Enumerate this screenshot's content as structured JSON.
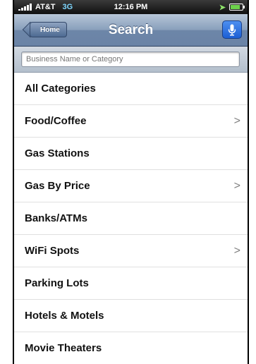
{
  "status_bar": {
    "carrier": "AT&T",
    "network": "3G",
    "time": "12:16 PM",
    "location_icon": "location-arrow-icon",
    "battery_level": 0.8
  },
  "nav": {
    "back_label": "Home",
    "title": "Search",
    "mic_icon": "microphone-icon"
  },
  "search": {
    "placeholder": "Business Name or Category",
    "value": ""
  },
  "categories": [
    {
      "label": "All Categories",
      "has_chevron": false
    },
    {
      "label": "Food/Coffee",
      "has_chevron": true
    },
    {
      "label": "Gas Stations",
      "has_chevron": false
    },
    {
      "label": "Gas By Price",
      "has_chevron": true
    },
    {
      "label": "Banks/ATMs",
      "has_chevron": false
    },
    {
      "label": "WiFi Spots",
      "has_chevron": true
    },
    {
      "label": "Parking Lots",
      "has_chevron": false
    },
    {
      "label": "Hotels & Motels",
      "has_chevron": false
    },
    {
      "label": "Movie Theaters",
      "has_chevron": false
    }
  ],
  "chevron_glyph": ">"
}
